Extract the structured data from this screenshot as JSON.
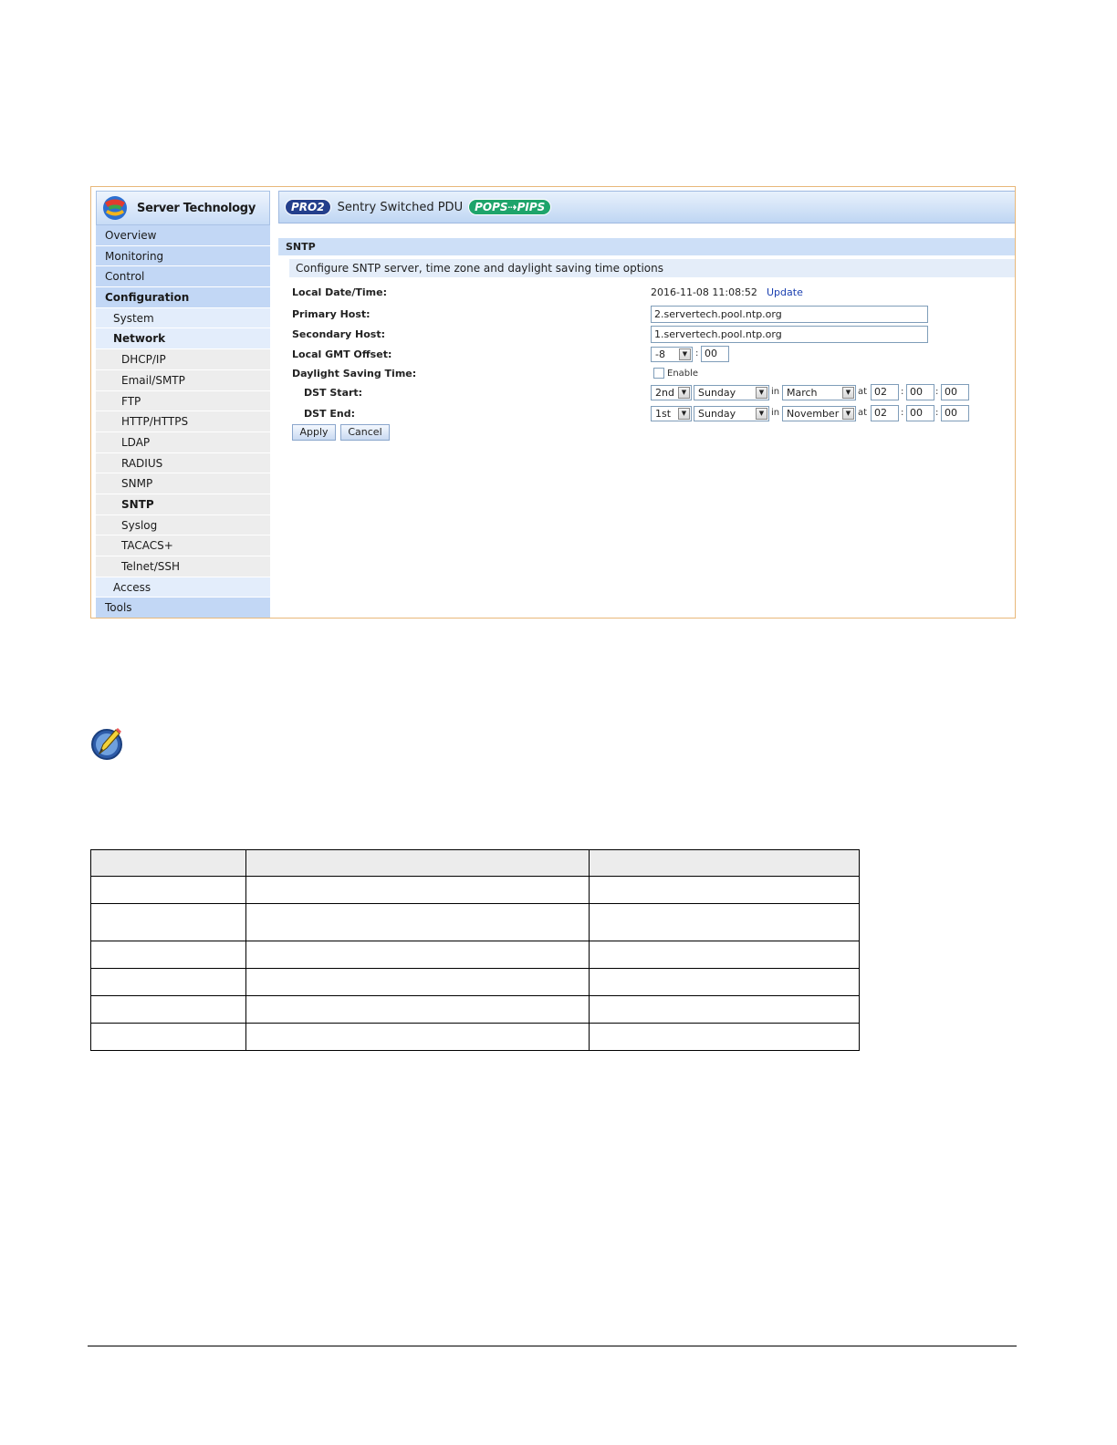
{
  "sidebar": {
    "logo_text": "Server Technology",
    "items": [
      {
        "label": "Overview"
      },
      {
        "label": "Monitoring"
      },
      {
        "label": "Control"
      },
      {
        "label": "Configuration"
      },
      {
        "label": "System"
      },
      {
        "label": "Network"
      },
      {
        "label": "DHCP/IP"
      },
      {
        "label": "Email/SMTP"
      },
      {
        "label": "FTP"
      },
      {
        "label": "HTTP/HTTPS"
      },
      {
        "label": "LDAP"
      },
      {
        "label": "RADIUS"
      },
      {
        "label": "SNMP"
      },
      {
        "label": "SNTP"
      },
      {
        "label": "Syslog"
      },
      {
        "label": "TACACS+"
      },
      {
        "label": "Telnet/SSH"
      },
      {
        "label": "Access"
      },
      {
        "label": "Tools"
      }
    ]
  },
  "banner": {
    "pro_badge": "PRO2",
    "title": "Sentry Switched PDU",
    "pops_badge": "POPS⇢PIPS"
  },
  "page": {
    "section": "SNTP",
    "description": "Configure SNTP server, time zone and daylight saving time options"
  },
  "form": {
    "local_time_label": "Local Date/Time:",
    "local_time_value": "2016-11-08 11:08:52",
    "update_link": "Update",
    "primary_label": "Primary Host:",
    "primary_value": "2.servertech.pool.ntp.org",
    "secondary_label": "Secondary Host:",
    "secondary_value": "1.servertech.pool.ntp.org",
    "gmt_label": "Local GMT Offset:",
    "gmt_hours": "-8",
    "gmt_colon": ":",
    "gmt_minutes": "00",
    "dst_label": "Daylight Saving Time:",
    "dst_enable_label": "Enable",
    "dst_enabled": false,
    "dst_start_label": "DST Start:",
    "dst_start": {
      "week": "2nd",
      "day": "Sunday",
      "in": "in",
      "month": "March",
      "at": "at",
      "hh": "02",
      "mm": "00",
      "ss": "00"
    },
    "dst_end_label": "DST End:",
    "dst_end": {
      "week": "1st",
      "day": "Sunday",
      "in": "in",
      "month": "November",
      "at": "at",
      "hh": "02",
      "mm": "00",
      "ss": "00"
    },
    "time_sep": ":",
    "apply": "Apply",
    "cancel": "Cancel"
  },
  "icons": {
    "dropdown": "chevron-down-icon",
    "note": "pencil-note-icon"
  },
  "colors": {
    "sidebar_level1": "#c2d7f5",
    "sidebar_level2": "#e3edfb",
    "sidebar_level3": "#ededed",
    "link": "#1a3fb0",
    "frame_border": "#e8b87a"
  }
}
